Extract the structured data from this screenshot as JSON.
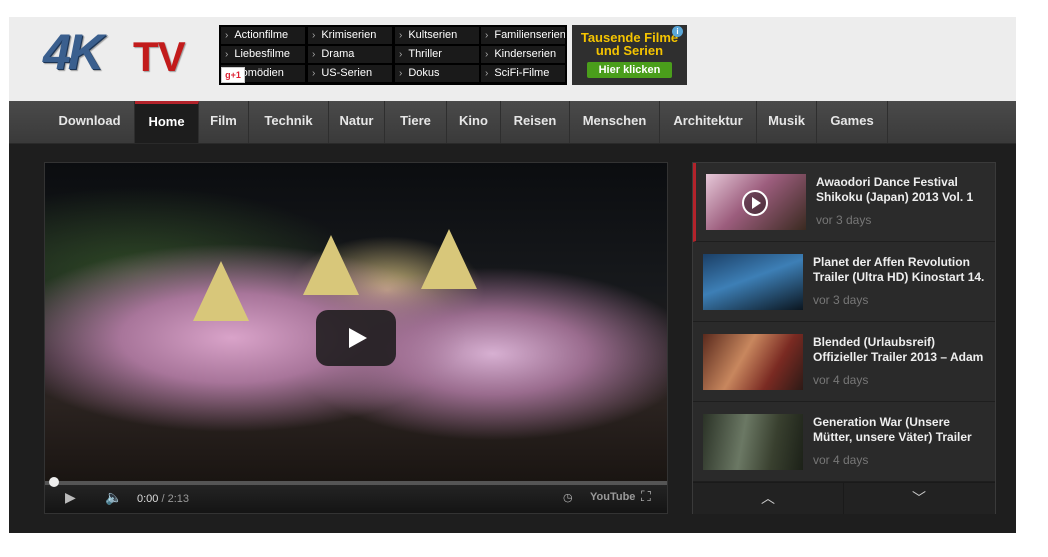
{
  "logo": {
    "part1": "4K",
    "part2": "TV"
  },
  "ad_links": [
    [
      "Actionfilme",
      "Krimiserien",
      "Kultserien",
      "Familienserien"
    ],
    [
      "Liebesfilme",
      "Drama",
      "Thriller",
      "Kinderserien"
    ],
    [
      "Komödien",
      "US-Serien",
      "Dokus",
      "SciFi-Filme"
    ]
  ],
  "gplus": "g+1",
  "ad_box": {
    "title": "Tausende Filme und Serien",
    "button": "Hier klicken",
    "info": "i"
  },
  "nav": [
    "Download",
    "Home",
    "Film",
    "Technik",
    "Natur",
    "Tiere",
    "Kino",
    "Reisen",
    "Menschen",
    "Architektur",
    "Musik",
    "Games"
  ],
  "nav_active": "Home",
  "player": {
    "current_time": "0:00",
    "separator": " / ",
    "duration": "2:13",
    "brand": "YouTube",
    "progress": 0
  },
  "videos": [
    {
      "title": "Awaodori Dance Festival Shikoku (Japan) 2013 Vol. 1",
      "age": "vor 3 days"
    },
    {
      "title": "Planet der Affen Revolution Trailer (Ultra HD) Kinostart 14.",
      "age": "vor 3 days"
    },
    {
      "title": "Blended (Urlaubsreif) Offizieller Trailer 2013 – Adam",
      "age": "vor 4 days"
    },
    {
      "title": "Generation War (Unsere Mütter, unsere Väter) Trailer",
      "age": "vor 4 days"
    }
  ],
  "colors": {
    "accent": "#b3232b",
    "nav_bg": "#434343",
    "page_bg": "#1e1e1e",
    "ad_yellow": "#f5c400",
    "ad_green": "#4a9e1b"
  }
}
